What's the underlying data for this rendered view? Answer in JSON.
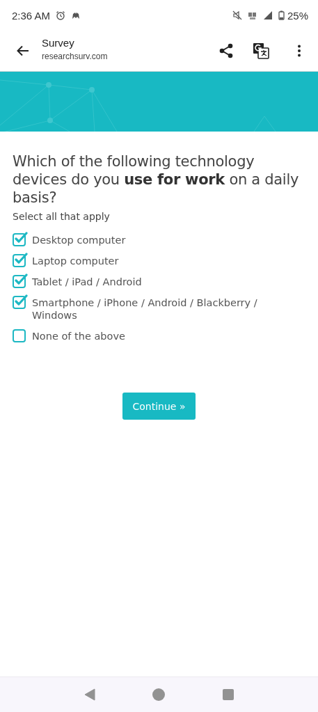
{
  "status_bar": {
    "time": "2:36 AM",
    "battery": "25%"
  },
  "toolbar": {
    "title": "Survey",
    "url": "researchsurv.com"
  },
  "question": {
    "text": "Which of the following technology devices do you **use for work** on a daily basis?",
    "hint": "Select all that apply"
  },
  "options": [
    {
      "label": "Desktop computer",
      "checked": true
    },
    {
      "label": "Laptop computer",
      "checked": true
    },
    {
      "label": "Tablet / iPad / Android",
      "checked": true
    },
    {
      "label": "Smartphone / iPhone / Android / Blackberry / Windows",
      "checked": true
    },
    {
      "label": "None of the above",
      "checked": false
    }
  ],
  "continue_button": "Continue »"
}
